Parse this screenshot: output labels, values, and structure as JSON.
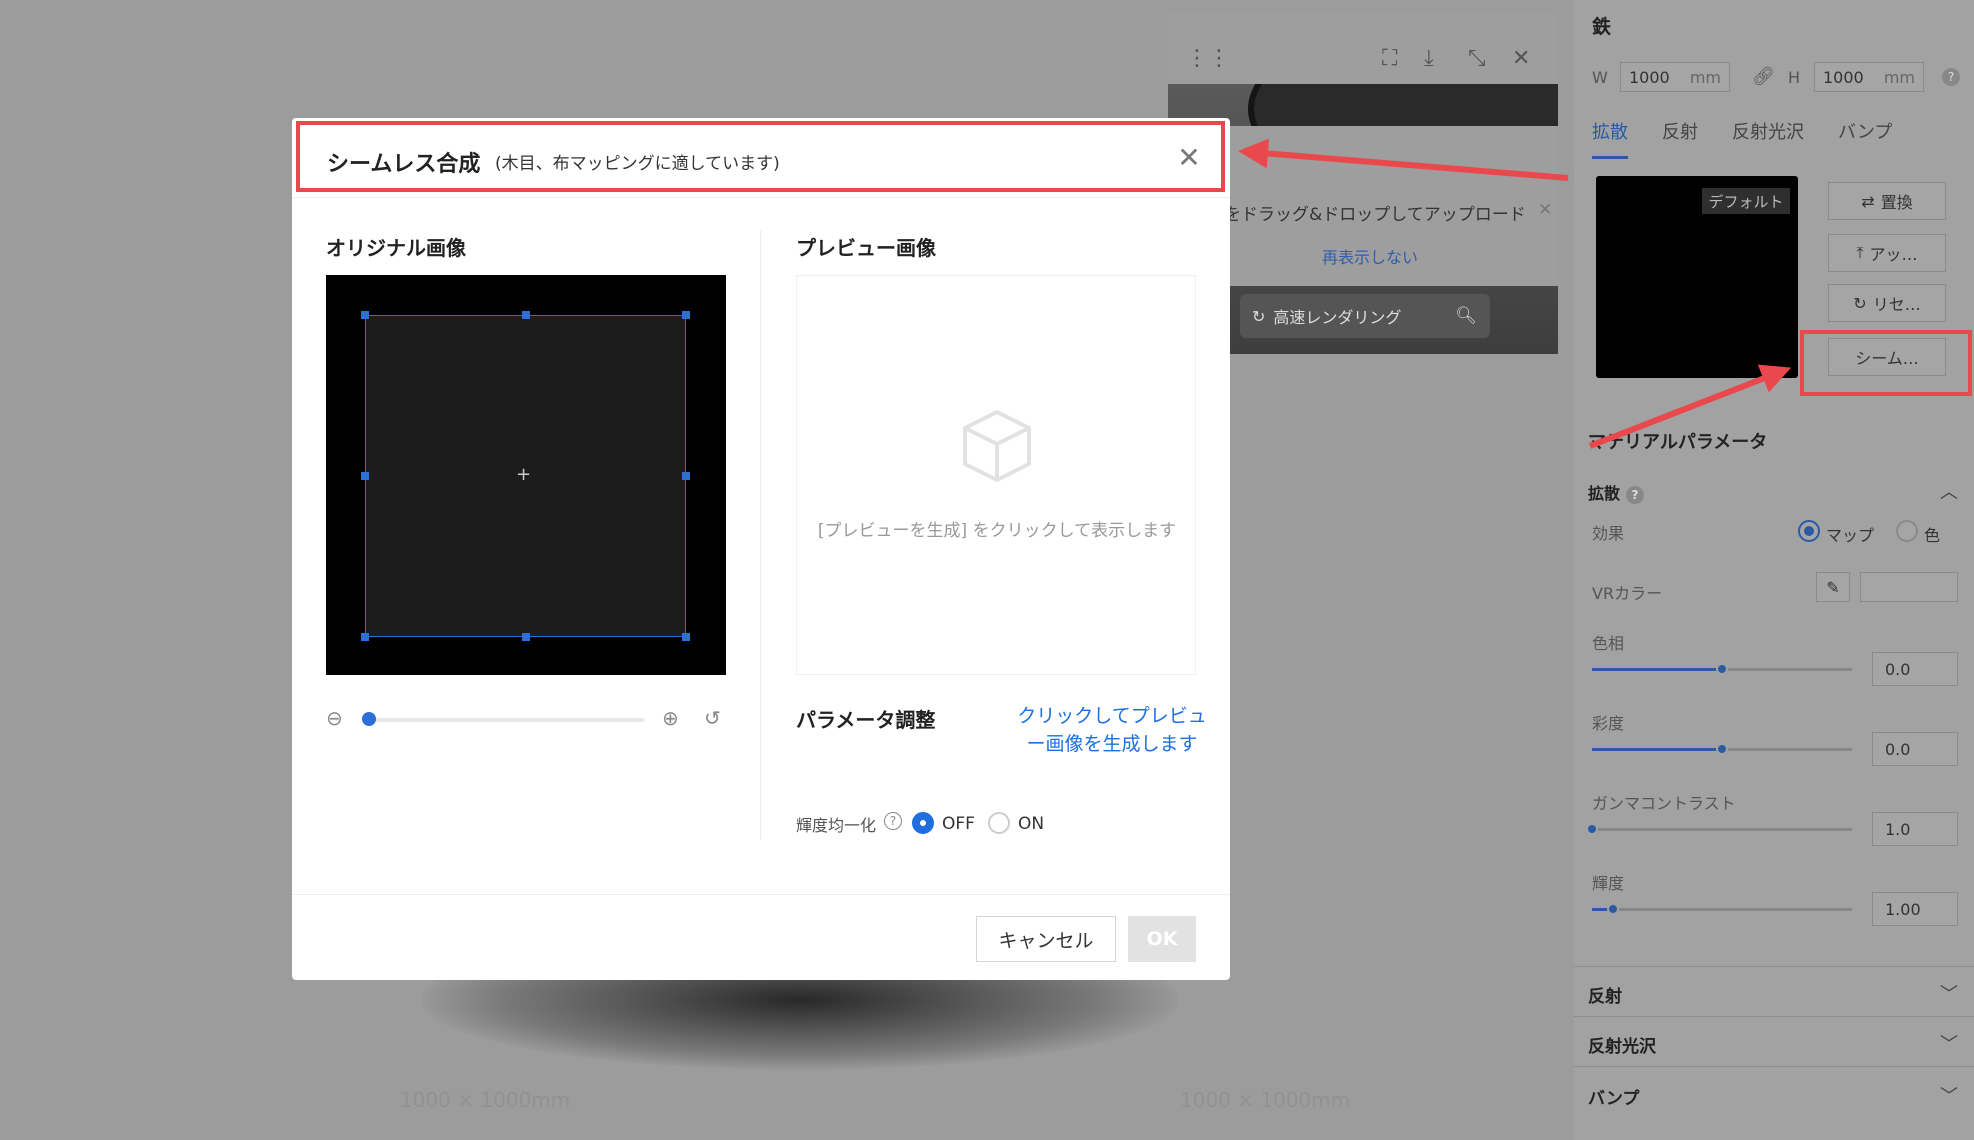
{
  "canvas": {
    "dim_left": "1000 × 1000mm",
    "dim_right": "1000 × 1000mm"
  },
  "render_view": {
    "upload_tip": "をドラッグ&ドロップしてアップロード",
    "dont_show_again": "再表示しない",
    "fast_render": "高速レンダリング",
    "icons": [
      "screenshot-icon",
      "download-icon",
      "collapse-icon",
      "close-icon",
      "drag-handle-icon",
      "search-icon"
    ]
  },
  "panel": {
    "material_name": "鉄",
    "width_label": "W",
    "width_value": "1000",
    "height_label": "H",
    "height_value": "1000",
    "unit": "mm",
    "tabs": [
      {
        "label": "拡散",
        "active": true
      },
      {
        "label": "反射",
        "active": false
      },
      {
        "label": "反射光沢",
        "active": false
      },
      {
        "label": "バンプ",
        "active": false
      }
    ],
    "default_badge": "デフォルト",
    "buttons": {
      "replace": "置換",
      "upload": "アッ…",
      "reset": "リセ…",
      "seamless": "シーム…"
    },
    "material_params_title": "マテリアルパラメータ",
    "diffuse_section": "拡散",
    "effect_label": "効果",
    "effect_options": [
      "マップ",
      "色"
    ],
    "effect_selected": "マップ",
    "vr_color_label": "VRカラー",
    "params": [
      {
        "label": "色相",
        "value": "0.0",
        "level": 0.5
      },
      {
        "label": "彩度",
        "value": "0.0",
        "level": 0.5
      },
      {
        "label": "ガンマコントラスト",
        "value": "1.0",
        "level": 0.0
      },
      {
        "label": "輝度",
        "value": "1.00",
        "level": 0.08
      }
    ],
    "collapsed_sections": [
      "反射",
      "反射光沢",
      "バンプ"
    ]
  },
  "modal": {
    "title": "シームレス合成",
    "subtitle": "(木目、布マッピングに適しています)",
    "original_title": "オリジナル画像",
    "preview_title": "プレビュー画像",
    "preview_hint": "[プレビューを生成] をクリックして表示します",
    "param_title": "パラメータ調整",
    "generate_link": "クリックしてプレビュー画像を生成します",
    "luminance_label": "輝度均一化",
    "luminance_options": [
      "OFF",
      "ON"
    ],
    "luminance_selected": "OFF",
    "zoom_level": 0.0,
    "cancel_label": "キャンセル",
    "ok_label": "OK"
  },
  "colors": {
    "accent": "#1f6fe0",
    "annotation": "#e9484d"
  }
}
